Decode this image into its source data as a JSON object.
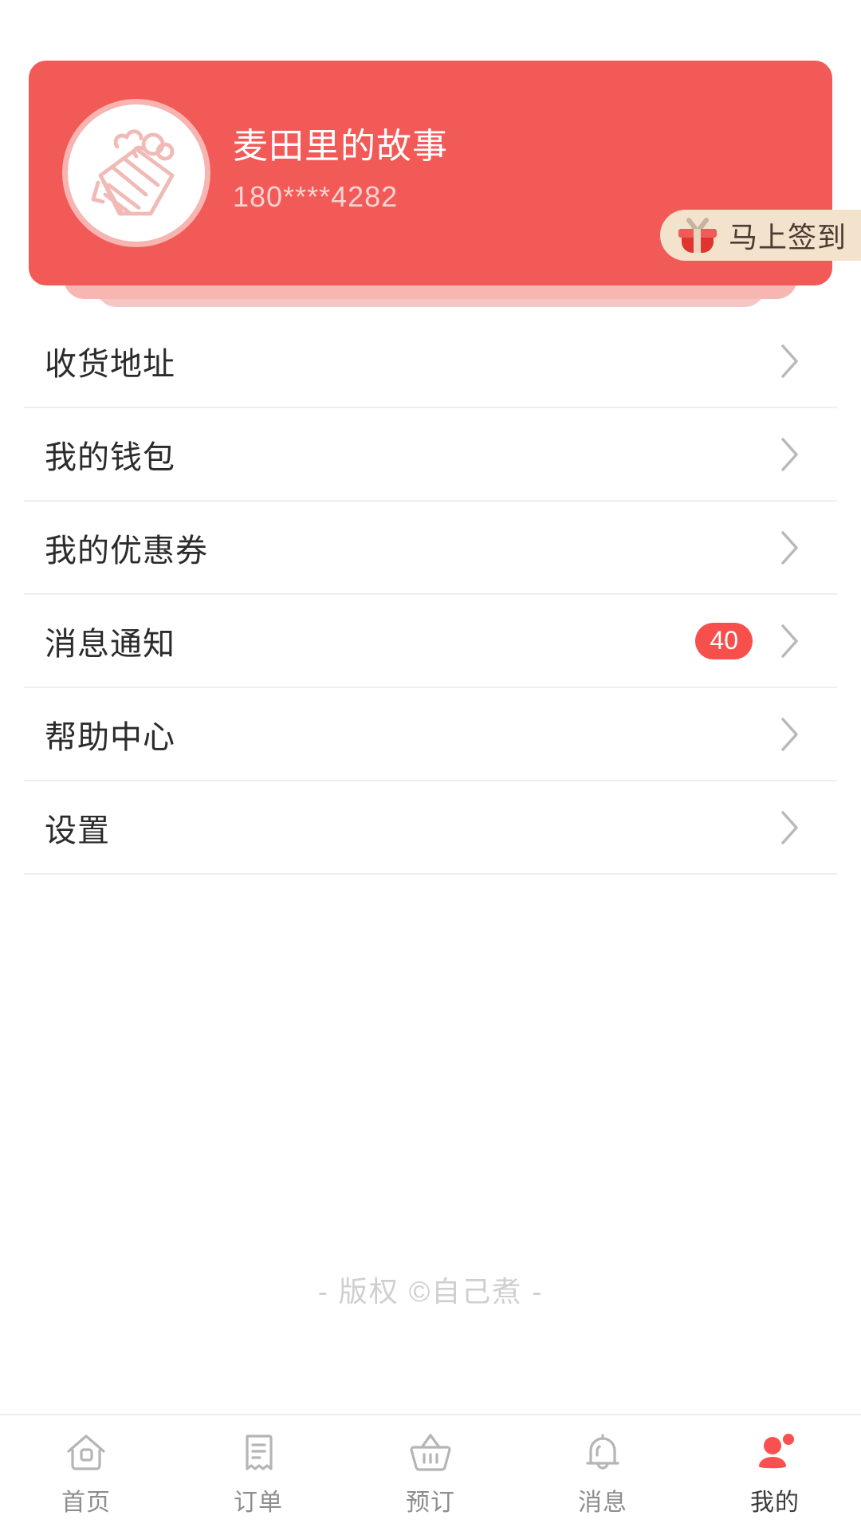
{
  "theme": {
    "brand_red": "#f25a58",
    "badge_red": "#f7504c",
    "active_tab_red": "#fa5150",
    "signin_bg": "#f4e3cc",
    "divider": "#eeeeee",
    "muted_text": "#cfcfcf"
  },
  "profile": {
    "name": "麦田里的故事",
    "phone": "180****4282",
    "avatar_icon": "shopping-basket-icon",
    "signin": {
      "label": "马上签到",
      "icon": "gift-icon"
    }
  },
  "menu": {
    "items": [
      {
        "label": "收货地址",
        "badge": null,
        "chevron": "chevron-right-icon"
      },
      {
        "label": "我的钱包",
        "badge": null,
        "chevron": "chevron-right-icon"
      },
      {
        "label": "我的优惠券",
        "badge": null,
        "chevron": "chevron-right-icon"
      },
      {
        "label": "消息通知",
        "badge": "40",
        "chevron": "chevron-right-icon"
      },
      {
        "label": "帮助中心",
        "badge": null,
        "chevron": "chevron-right-icon"
      },
      {
        "label": "设置",
        "badge": null,
        "chevron": "chevron-right-icon"
      }
    ]
  },
  "footer": {
    "copyright": "- 版权 ©自己煮 -"
  },
  "tabbar": {
    "items": [
      {
        "label": "首页",
        "icon": "home-icon",
        "active": false
      },
      {
        "label": "订单",
        "icon": "receipt-icon",
        "active": false
      },
      {
        "label": "预订",
        "icon": "basket-icon",
        "active": false
      },
      {
        "label": "消息",
        "icon": "bell-icon",
        "active": false
      },
      {
        "label": "我的",
        "icon": "user-icon",
        "active": true
      }
    ]
  }
}
